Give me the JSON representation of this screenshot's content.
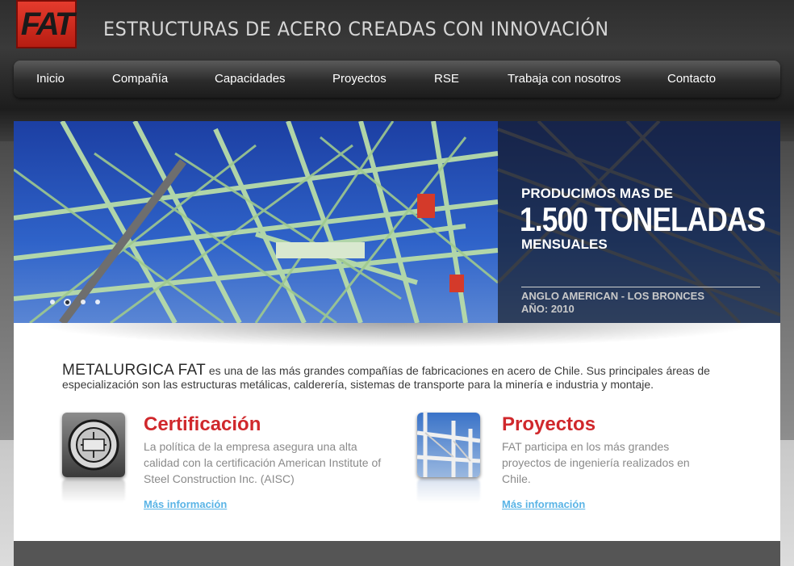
{
  "header": {
    "logo_text": "FAT",
    "tagline": "ESTRUCTURAS DE ACERO CREADAS CON INNOVACIÓN"
  },
  "nav": {
    "items": [
      {
        "label": "Inicio"
      },
      {
        "label": "Compañía"
      },
      {
        "label": "Capacidades"
      },
      {
        "label": "Proyectos"
      },
      {
        "label": "RSE"
      },
      {
        "label": "Trabaja con nosotros"
      },
      {
        "label": "Contacto"
      }
    ]
  },
  "hero": {
    "caption_top": "PRODUCIMOS MAS DE",
    "caption_big": "1.500 TONELADAS",
    "caption_bottom": "MENSUALES",
    "project": "ANGLO AMERICAN - LOS BRONCES",
    "year": "AÑO: 2010",
    "slides_count": 4,
    "active_slide": 2
  },
  "intro": {
    "brand": "METALURGICA FAT",
    "text": " es una de las más grandes compañías de fabricaciones en acero de Chile. Sus principales áreas de especialización son las estructuras metálicas, calderería, sistemas de transporte para la minería e industria y montaje."
  },
  "cards": [
    {
      "icon": "aisc-seal-icon",
      "title": "Certificación",
      "text": "La política de la empresa asegura una alta calidad con la certificación American Institute of Steel Construction Inc. (AISC)",
      "link": "Más información"
    },
    {
      "icon": "steel-structure-icon",
      "title": "Proyectos",
      "text": "FAT participa en los más grandes proyectos de ingeniería realizados en Chile.",
      "link": "Más información"
    }
  ],
  "colors": {
    "accent_red": "#d0282c",
    "link_blue": "#5ab4e6",
    "logo_red": "#e53b2d"
  }
}
